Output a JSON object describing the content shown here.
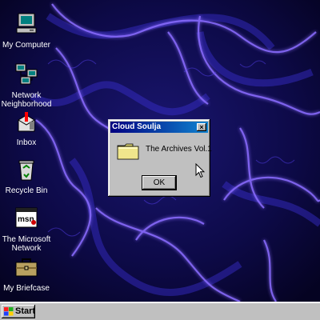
{
  "desktop": {
    "icons": [
      {
        "label": "My Computer",
        "icon": "my-computer-icon"
      },
      {
        "label": "Network Neighborhood",
        "icon": "network-neighborhood-icon"
      },
      {
        "label": "Inbox",
        "icon": "inbox-icon"
      },
      {
        "label": "Recycle Bin",
        "icon": "recycle-bin-icon"
      },
      {
        "label": "The Microsoft Network",
        "icon": "msn-icon"
      },
      {
        "label": "My Briefcase",
        "icon": "briefcase-icon"
      }
    ]
  },
  "dialog": {
    "title": "Cloud Soulja",
    "close_label": "×",
    "message": "The Archives Vol.1",
    "ok_label": "OK"
  },
  "taskbar": {
    "start_label": "Start"
  },
  "colors": {
    "title_bar": "#000080",
    "window_face": "#c0c0c0",
    "wallpaper_base": "#0a0836",
    "wallpaper_glow": "#8a6cff"
  }
}
